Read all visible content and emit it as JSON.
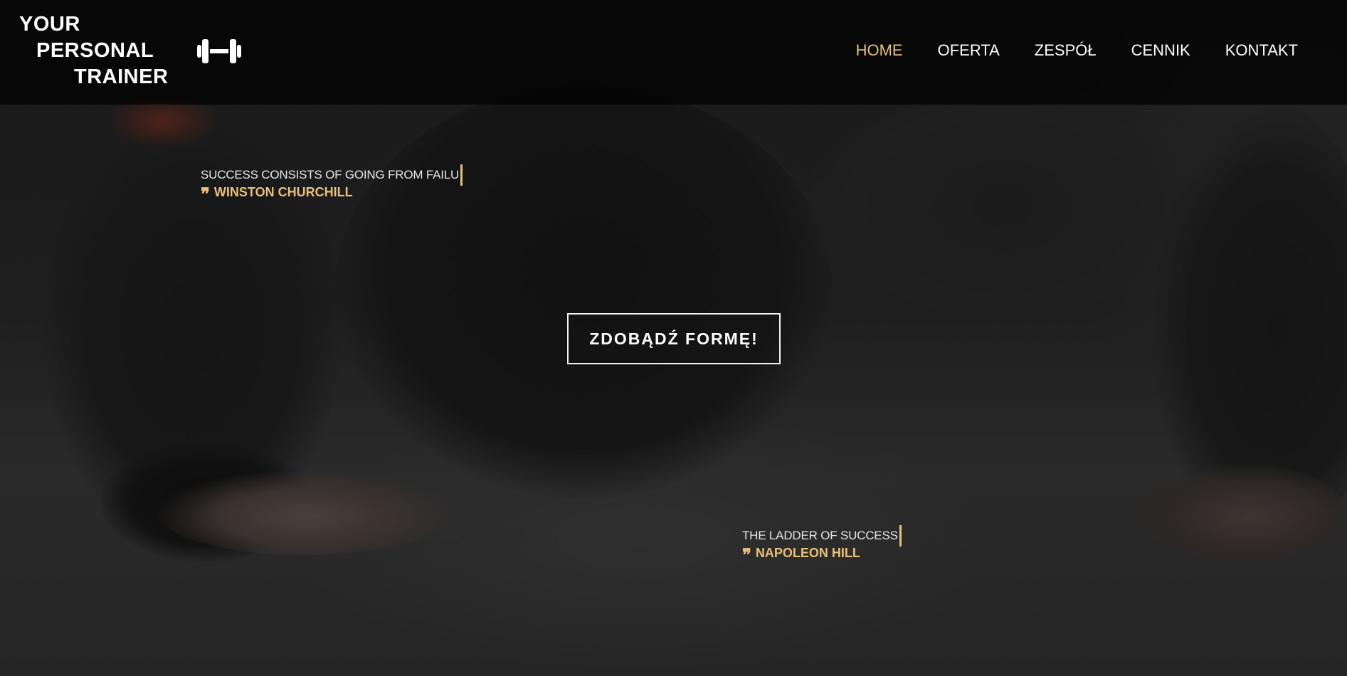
{
  "brand": {
    "lines": [
      "YOUR",
      "PERSONAL",
      "TRAINER"
    ],
    "icon": "dumbbell-icon"
  },
  "nav": {
    "items": [
      {
        "label": "HOME",
        "active": true
      },
      {
        "label": "OFERTA",
        "active": false
      },
      {
        "label": "ZESPÓŁ",
        "active": false
      },
      {
        "label": "CENNIK",
        "active": false
      },
      {
        "label": "KONTAKT",
        "active": false
      }
    ]
  },
  "hero": {
    "cta_label": "ZDOBĄDŹ FORMĘ!",
    "quotes": [
      {
        "text": "SUCCESS CONSISTS OF GOING FROM FAILU",
        "author": "WINSTON CHURCHILL",
        "icon": "quote-icon"
      },
      {
        "text": "THE LADDER OF SUCCESS",
        "author": "NAPOLEON HILL",
        "icon": "quote-icon"
      }
    ]
  },
  "colors": {
    "accent": "#e8c07a",
    "text": "#ffffff",
    "navbar_bg": "#000000"
  }
}
